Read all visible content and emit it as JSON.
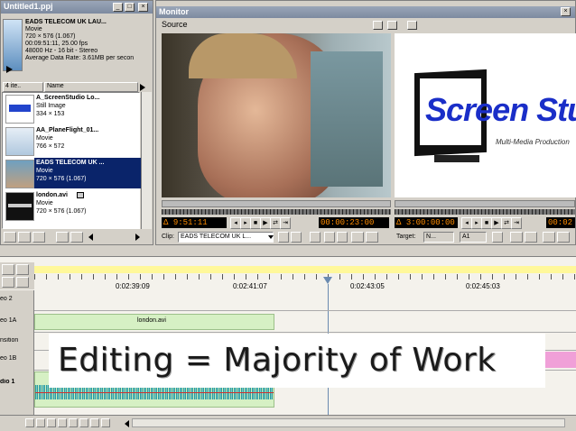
{
  "project": {
    "title": "Untitled1.ppj",
    "clip_name": "EADS TELECOM UK LAU...",
    "clip_type": "Movie",
    "clip_size": "720 × 576 (1.067)",
    "duration": "00:09:51:11, 25.00 fps",
    "audio": "48000 Hz - 16 bit - Stereo",
    "data_rate": "Average Data Rate: 3.61MB per secon",
    "items_count": "4 ite..",
    "name_header": "Name",
    "items": [
      {
        "name": "A_ScreenStudio Lo...",
        "type": "Still Image",
        "size": "334 × 153"
      },
      {
        "name": "AA_PlaneFlight_01...",
        "type": "Movie",
        "size": "766 × 572"
      },
      {
        "name": "EADS TELECOM UK ...",
        "type": "Movie",
        "size": "720 × 576 (1.067)"
      },
      {
        "name": "london.avi",
        "type": "Movie",
        "size": "720 × 576 (1.067)"
      }
    ]
  },
  "monitor": {
    "title": "Monitor",
    "source_label": "Source",
    "source_timecode_left": "9:51:11",
    "source_timecode_right": "00:00:23:00",
    "program_timecode_left": "3:00:00:00",
    "program_timecode_right": "00:02",
    "clip_label": "Clip:",
    "clip_value": "EADS TELECOM UK L...",
    "target_label": "Target:",
    "target_value": "N...",
    "target_track": "A1",
    "logo_text": "Screen Stu",
    "logo_tagline": "Multi-Media Production"
  },
  "timeline": {
    "timecodes": [
      "0:02:39:09",
      "0:02:41:07",
      "0:02:43:05",
      "0:02:45:03"
    ],
    "tracks": [
      "eo 2",
      "eo 1A",
      "nsition",
      "eo 1B",
      "dio 1"
    ],
    "clip_name": "london.avi"
  },
  "caption": "Editing =  Majority of Work",
  "colors": {
    "titlebar": "#7d8aa0",
    "selection": "#0a246a",
    "timecode": "#ff8c00",
    "video_clip": "#d6f0c4",
    "audio_wave": "#2a9a9a",
    "transition_pink": "#f0a0d8",
    "timeline_yellow": "#fff89a",
    "caption_bg": "#ffffff"
  }
}
